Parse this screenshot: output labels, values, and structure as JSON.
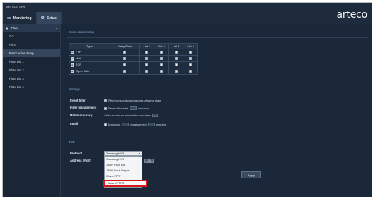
{
  "app": {
    "title": "ARTECO LPR",
    "logo": "arteco"
  },
  "nav": {
    "tabs": [
      {
        "label": "Monitoring",
        "icon": "monitor-icon"
      },
      {
        "label": "Setup",
        "icon": "gear-icon"
      }
    ]
  },
  "sidebar": {
    "header": "Plate",
    "items": [
      {
        "label": "Ocr"
      },
      {
        "label": "Print"
      },
      {
        "label": "Event action setup"
      },
      {
        "label": "Plate List 1"
      },
      {
        "label": "Plate List 2"
      },
      {
        "label": "Plate List 3"
      },
      {
        "label": "Plate List 4"
      }
    ]
  },
  "event_action": {
    "title": "Event action setup",
    "columns": [
      "Type",
      "Every Plate",
      "List 1",
      "List 2",
      "List 3",
      "List 4"
    ],
    "rows": [
      {
        "type": "FTP",
        "checks": [
          false,
          false,
          false,
          false,
          false
        ]
      },
      {
        "type": "Mail",
        "checks": [
          false,
          false,
          false,
          false,
          false
        ]
      },
      {
        "type": "TCP",
        "checks": [
          true,
          false,
          false,
          false,
          false
        ]
      },
      {
        "type": "Open Gate",
        "checks": [
          false,
          false,
          false,
          false,
          false
        ]
      }
    ]
  },
  "settings": {
    "title": "Settings",
    "event_filter": {
      "label": "Event filter",
      "text": "Filter consecutives matches of same plate"
    },
    "filter_management": {
      "label": "Filter management",
      "text_before": "Reset filter after",
      "text_after": "seconds"
    },
    "match_accuracy": {
      "label": "Match accuracy",
      "text": "Allow maximum mismatch characters"
    },
    "email": {
      "label": "Email",
      "text_before": "Maximum",
      "text_mid": "emails every",
      "text_after": "minutes"
    }
  },
  "tcp": {
    "title": "TCP",
    "protocol_label": "Protocol",
    "address_label": "Address / Port",
    "protocol_selected": "Samsung NVR",
    "options": [
      "Samsung NVR",
      "JSON Push Full",
      "JSON Push Simple",
      "Wave HTTP",
      "Wave HTTPS"
    ],
    "highlighted_option": "Wave HTTPS",
    "port_value": "1234"
  },
  "apply_label": "Apply"
}
